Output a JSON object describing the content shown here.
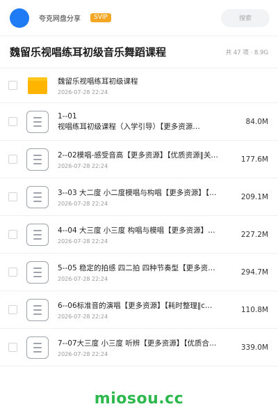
{
  "header": {
    "username": "夸克网盘分享",
    "badge": "SVIP",
    "search_placeholder": "搜索"
  },
  "share": {
    "title": "魏留乐视唱练耳初级音乐舞蹈课程",
    "meta": "共 47 项 · 8.9G"
  },
  "items": [
    {
      "type": "folder",
      "name": "魏留乐视唱练耳初级课程",
      "date": "2026-07-28 22:24"
    },
    {
      "type": "file",
      "name": "1--01",
      "name2": "视唱练耳初级课程（入学引导）【更多资源…",
      "size": "84.0M"
    },
    {
      "type": "file",
      "name": "2--02模唱-感受音高【更多资源】【优质资源‖关…",
      "date": "2026-07-28 22:24",
      "size": "177.6M"
    },
    {
      "type": "file",
      "name": "3--03 大二度 小二度模唱与构唱【更多资源】【…",
      "date": "2026-07-28 22:24",
      "size": "209.1M"
    },
    {
      "type": "file",
      "name": "4--04 大三度 小三度 构唱与模唱【更多资源】…",
      "date": "2026-07-28 22:24",
      "size": "227.2M"
    },
    {
      "type": "file",
      "name": "5--05 稳定的拍感 四二拍 四种节奏型【更多资…",
      "date": "2026-07-28 22:24",
      "size": "294.7M"
    },
    {
      "type": "file",
      "name": "6--06标准音的演唱【更多资源】【耗时整理‖c…",
      "date": "2026-07-28 22:24",
      "size": "110.8M"
    },
    {
      "type": "file",
      "name": "7--07大三度 小三度 听辨【更多资源】【优质合…",
      "date": "2026-07-28 22:24",
      "size": "339.0M"
    }
  ],
  "watermark": "miosou.cc",
  "colors": {
    "accent": "#1f7cf5",
    "svip": "#f5a623",
    "folder": "#ffb400",
    "watermark": "#2db84d"
  },
  "icons": {
    "folder": "folder-icon",
    "file": "document-icon"
  }
}
